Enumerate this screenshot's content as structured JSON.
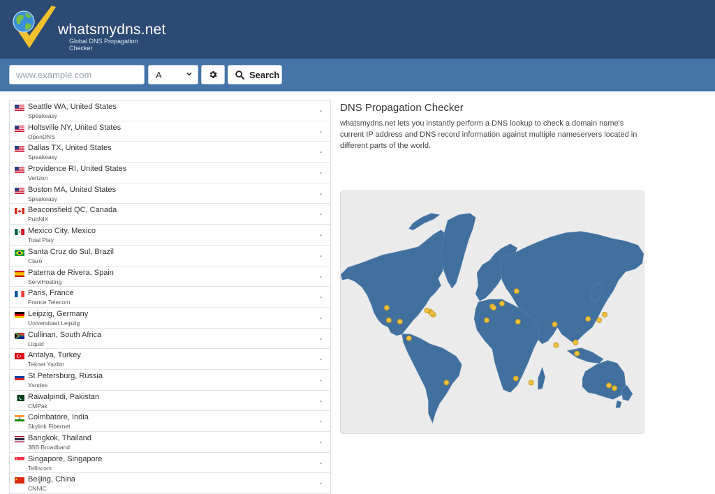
{
  "brand": {
    "name": "whatsmydns.net",
    "tagline": "Global DNS Propagation Checker"
  },
  "search": {
    "placeholder": "www.example.com",
    "value": "",
    "record_type": "A",
    "search_label": "Search"
  },
  "info": {
    "title": "DNS Propagation Checker",
    "description": "whatsmydns.net lets you instantly perform a DNS lookup to check a domain name's current IP address and DNS record information against multiple nameservers located in different parts of the world."
  },
  "colors": {
    "header": "#2c4a73",
    "toolbar": "#4474a8",
    "map_land": "#41709f",
    "map_marker": "#f3c23e"
  },
  "servers": [
    {
      "location": "Seattle WA, United States",
      "provider": "Speakeasy",
      "flag": "us",
      "result": "-"
    },
    {
      "location": "Holtsville NY, United States",
      "provider": "OpenDNS",
      "flag": "us",
      "result": "-"
    },
    {
      "location": "Dallas TX, United States",
      "provider": "Speakeasy",
      "flag": "us",
      "result": "-"
    },
    {
      "location": "Providence RI, United States",
      "provider": "Verizon",
      "flag": "us",
      "result": "-"
    },
    {
      "location": "Boston MA, United States",
      "provider": "Speakeasy",
      "flag": "us",
      "result": "-"
    },
    {
      "location": "Beaconsfield QC, Canada",
      "provider": "PubNIX",
      "flag": "ca",
      "result": "-"
    },
    {
      "location": "Mexico City, Mexico",
      "provider": "Total Play",
      "flag": "mx",
      "result": "-"
    },
    {
      "location": "Santa Cruz do Sul, Brazil",
      "provider": "Claro",
      "flag": "br",
      "result": "-"
    },
    {
      "location": "Paterna de Rivera, Spain",
      "provider": "ServiHosting",
      "flag": "es",
      "result": "-"
    },
    {
      "location": "Paris, France",
      "provider": "France Telecom",
      "flag": "fr",
      "result": "-"
    },
    {
      "location": "Leipzig, Germany",
      "provider": "Universitaet Leipzig",
      "flag": "de",
      "result": "-"
    },
    {
      "location": "Cullinan, South Africa",
      "provider": "Liquid",
      "flag": "za",
      "result": "-"
    },
    {
      "location": "Antalya, Turkey",
      "provider": "Teknet Yazlim",
      "flag": "tr",
      "result": "-"
    },
    {
      "location": "St Petersburg, Russia",
      "provider": "Yandex",
      "flag": "ru",
      "result": "-"
    },
    {
      "location": "Rawalpindi, Pakistan",
      "provider": "CMPak",
      "flag": "pk",
      "result": "-"
    },
    {
      "location": "Coimbatore, India",
      "provider": "Skylink Fibernet",
      "flag": "in",
      "result": "-"
    },
    {
      "location": "Bangkok, Thailand",
      "provider": "3BB Broadband",
      "flag": "th",
      "result": "-"
    },
    {
      "location": "Singapore, Singapore",
      "provider": "Tefincom",
      "flag": "sg",
      "result": "-"
    },
    {
      "location": "Beijing, China",
      "provider": "CNNIC",
      "flag": "cn",
      "result": "-"
    }
  ]
}
